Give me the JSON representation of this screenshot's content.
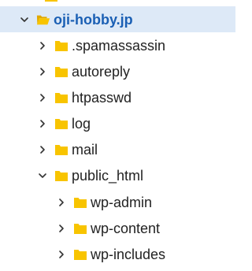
{
  "colors": {
    "selected_background": "#dde9f7",
    "selected_text": "#1a5fb4",
    "folder_yellow": "#f8c400",
    "chevron": "#333333",
    "text": "#222222"
  },
  "tree": {
    "root": {
      "label": "oji-hobby.jp",
      "state": "expanded",
      "selected": true,
      "icon": "folder-open-icon"
    },
    "items": [
      {
        "label": ".spamassassin",
        "state": "collapsed",
        "icon": "folder-icon",
        "depth": 1
      },
      {
        "label": "autoreply",
        "state": "collapsed",
        "icon": "folder-icon",
        "depth": 1
      },
      {
        "label": "htpasswd",
        "state": "collapsed",
        "icon": "folder-icon",
        "depth": 1
      },
      {
        "label": "log",
        "state": "collapsed",
        "icon": "folder-icon",
        "depth": 1
      },
      {
        "label": "mail",
        "state": "collapsed",
        "icon": "folder-icon",
        "depth": 1
      },
      {
        "label": "public_html",
        "state": "expanded",
        "icon": "folder-icon",
        "depth": 1
      },
      {
        "label": "wp-admin",
        "state": "collapsed",
        "icon": "folder-icon",
        "depth": 2
      },
      {
        "label": "wp-content",
        "state": "collapsed",
        "icon": "folder-icon",
        "depth": 2
      },
      {
        "label": "wp-includes",
        "state": "collapsed",
        "icon": "folder-icon",
        "depth": 2
      }
    ]
  }
}
